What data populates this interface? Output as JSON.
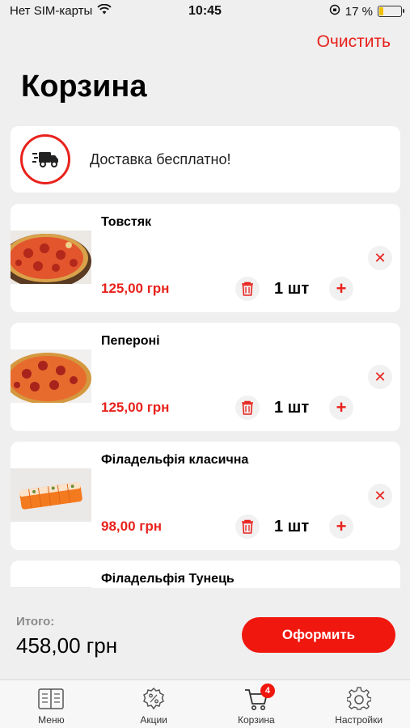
{
  "status_bar": {
    "carrier": "Нет SIM-карты",
    "time": "10:45",
    "battery": "17 %",
    "battery_level": 0.17
  },
  "header": {
    "clear_label": "Очистить",
    "title": "Корзина"
  },
  "delivery": {
    "text": "Доставка бесплатно!"
  },
  "cart": {
    "items": [
      {
        "name": "Товстяк",
        "price": "125,00 грн",
        "qty": "1 шт",
        "image": "pizza"
      },
      {
        "name": "Пепероні",
        "price": "125,00 грн",
        "qty": "1 шт",
        "image": "pizza"
      },
      {
        "name": "Філадельфія класична",
        "price": "98,00 грн",
        "qty": "1 шт",
        "image": "sushi"
      },
      {
        "name": "Філадельфія Тунець",
        "price": "",
        "qty": "",
        "image": "sushi"
      }
    ]
  },
  "summary": {
    "total_label": "Итого:",
    "total_value": "458,00 грн",
    "checkout_label": "Оформить"
  },
  "tabs": [
    {
      "label": "Меню",
      "icon": "menu-book-icon"
    },
    {
      "label": "Акции",
      "icon": "discount-badge-icon"
    },
    {
      "label": "Корзина",
      "icon": "cart-icon",
      "badge": "4"
    },
    {
      "label": "Настройки",
      "icon": "gear-icon"
    }
  ],
  "colors": {
    "accent": "#e8221c",
    "button": "#f0170f",
    "background": "#efefef",
    "card": "#ffffff"
  }
}
